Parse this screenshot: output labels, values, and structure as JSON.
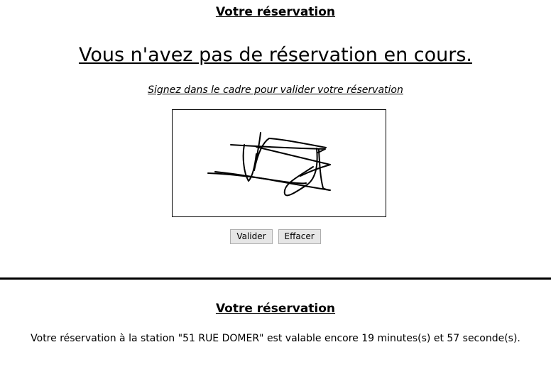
{
  "top_section": {
    "title": "Votre réservation",
    "status_message": "Vous n'avez pas de réservation en cours.",
    "sign_instruction": "Signez dans le cadre pour valider votre réservation",
    "buttons": {
      "validate_label": "Valider",
      "clear_label": "Effacer"
    }
  },
  "bottom_section": {
    "title": "Votre réservation",
    "info": "Votre réservation à la station \"51 RUE DOMER\" est valable encore 19 minutes(s) et 57 seconde(s)."
  }
}
